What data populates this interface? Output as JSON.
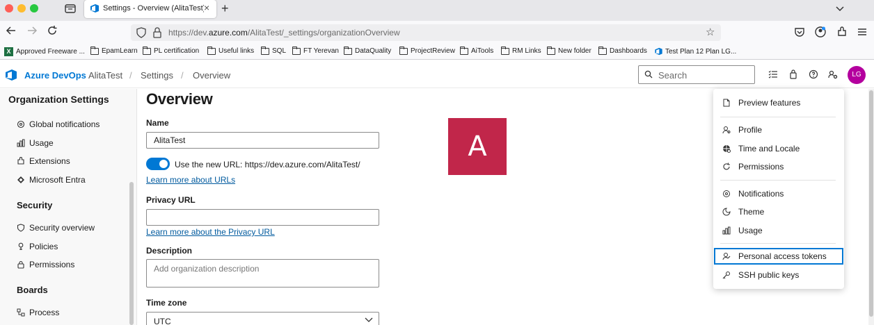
{
  "browser": {
    "tab_title": "Settings - Overview (AlitaTest) -",
    "url_prefix": "https://dev.",
    "url_domain": "azure.com",
    "url_path": "/AlitaTest/_settings/organizationOverview",
    "bookmarks": [
      {
        "label": "Approved Freeware ...",
        "icon": "excel-icon"
      },
      {
        "label": "EpamLearn",
        "icon": "folder-icon"
      },
      {
        "label": "PL certification",
        "icon": "folder-icon"
      },
      {
        "label": "Useful links",
        "icon": "folder-icon"
      },
      {
        "label": "SQL",
        "icon": "folder-icon"
      },
      {
        "label": "FT Yerevan",
        "icon": "folder-icon"
      },
      {
        "label": "DataQuality",
        "icon": "folder-icon"
      },
      {
        "label": "ProjectReview",
        "icon": "folder-icon"
      },
      {
        "label": "AiTools",
        "icon": "folder-icon"
      },
      {
        "label": "RM Links",
        "icon": "folder-icon"
      },
      {
        "label": "New folder",
        "icon": "folder-icon"
      },
      {
        "label": "Dashboards",
        "icon": "folder-icon"
      },
      {
        "label": "Test Plan 12 Plan LG...",
        "icon": "azure-devops-icon"
      }
    ]
  },
  "header": {
    "brand": "Azure DevOps",
    "breadcrumb": [
      "AlitaTest",
      "Settings",
      "Overview"
    ],
    "separator": "/",
    "search_placeholder": "Search",
    "avatar_initials": "LG",
    "avatar_color": "#b4009e"
  },
  "sidebar": {
    "title": "Organization Settings",
    "general_items": [
      {
        "label": "Global notifications",
        "icon": "notification-icon"
      },
      {
        "label": "Usage",
        "icon": "usage-icon"
      },
      {
        "label": "Extensions",
        "icon": "extensions-icon"
      },
      {
        "label": "Microsoft Entra",
        "icon": "entra-icon"
      }
    ],
    "security_heading": "Security",
    "security_items": [
      {
        "label": "Security overview",
        "icon": "shield-icon"
      },
      {
        "label": "Policies",
        "icon": "policy-icon"
      },
      {
        "label": "Permissions",
        "icon": "lock-icon"
      }
    ],
    "boards_heading": "Boards",
    "boards_items": [
      {
        "label": "Process",
        "icon": "process-icon"
      }
    ]
  },
  "main": {
    "title": "Overview",
    "name_label": "Name",
    "name_value": "AlitaTest",
    "toggle_label": "Use the new URL: https://dev.azure.com/AlitaTest/",
    "toggle_on": true,
    "urls_link": "Learn more about URLs",
    "privacy_label": "Privacy URL",
    "privacy_value": "",
    "privacy_link": "Learn more about the Privacy URL",
    "description_label": "Description",
    "description_placeholder": "Add organization description",
    "timezone_label": "Time zone",
    "timezone_value": "UTC",
    "org_avatar_letter": "A",
    "org_avatar_color": "#c1264a"
  },
  "menu": {
    "items": [
      {
        "label": "Preview features",
        "icon": "document-icon"
      },
      {
        "label": "Profile",
        "icon": "profile-icon"
      },
      {
        "label": "Time and Locale",
        "icon": "globe-icon"
      },
      {
        "label": "Permissions",
        "icon": "refresh-icon"
      },
      {
        "label": "Notifications",
        "icon": "notification-icon"
      },
      {
        "label": "Theme",
        "icon": "theme-icon"
      },
      {
        "label": "Usage",
        "icon": "usage-icon"
      },
      {
        "label": "Personal access tokens",
        "icon": "token-icon",
        "active": true
      },
      {
        "label": "SSH public keys",
        "icon": "key-icon"
      }
    ]
  }
}
